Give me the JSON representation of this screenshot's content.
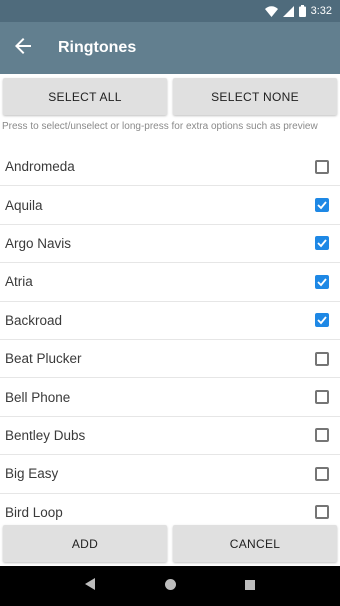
{
  "status_bar": {
    "time": "3:32"
  },
  "app_bar": {
    "title": "Ringtones"
  },
  "buttons": {
    "select_all": "SELECT ALL",
    "select_none": "SELECT NONE",
    "add": "ADD",
    "cancel": "CANCEL"
  },
  "hint": "Press to select/unselect or long-press for extra options such as preview",
  "ringtones": [
    {
      "name": "Andromeda",
      "checked": false
    },
    {
      "name": "Aquila",
      "checked": true
    },
    {
      "name": "Argo Navis",
      "checked": true
    },
    {
      "name": "Atria",
      "checked": true
    },
    {
      "name": "Backroad",
      "checked": true
    },
    {
      "name": "Beat Plucker",
      "checked": false
    },
    {
      "name": "Bell Phone",
      "checked": false
    },
    {
      "name": "Bentley Dubs",
      "checked": false
    },
    {
      "name": "Big Easy",
      "checked": false
    },
    {
      "name": "Bird Loop",
      "checked": false
    }
  ],
  "colors": {
    "status_bar": "#4f6b7c",
    "app_bar": "#627f8f",
    "checkbox_checked": "#1e88e5"
  },
  "icons": {
    "back": "arrow-back-icon",
    "wifi": "wifi-icon",
    "signal": "signal-icon",
    "battery": "battery-icon"
  }
}
